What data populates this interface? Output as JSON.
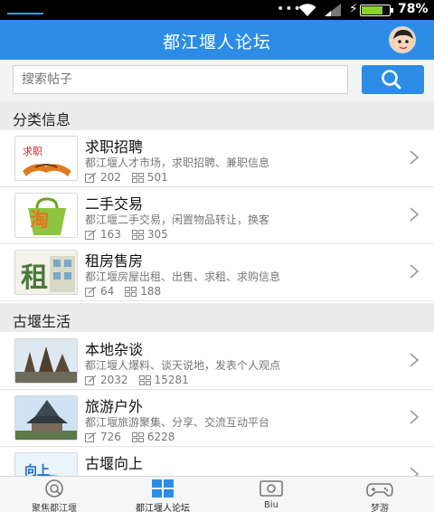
{
  "status_bar": {
    "battery_percent": "78%",
    "battery_level": 0.78
  },
  "header": {
    "title": "都江堰人论坛"
  },
  "search": {
    "placeholder": "搜索帖子"
  },
  "sections": [
    {
      "title": "分类信息",
      "items": [
        {
          "title": "求职招聘",
          "desc": "都江堰人才市场，求职招聘、兼职信息",
          "posts": "202",
          "views": "501",
          "thumb_text": "求职"
        },
        {
          "title": "二手交易",
          "desc": "都江堰二手交易，闲置物品转让，换客",
          "posts": "163",
          "views": "305",
          "thumb_text": "淘"
        },
        {
          "title": "租房售房",
          "desc": "都江堰房屋出租、出售、求租、求购信息",
          "posts": "64",
          "views": "188",
          "thumb_text": "租"
        }
      ]
    },
    {
      "title": "古堰生活",
      "items": [
        {
          "title": "本地杂谈",
          "desc": "都江堰人爆料、谈天说地，发表个人观点",
          "posts": "2032",
          "views": "15281"
        },
        {
          "title": "旅游户外",
          "desc": "都江堰旅游聚集、分享、交流互动平台",
          "posts": "726",
          "views": "6228"
        },
        {
          "title": "古堰向上",
          "desc": "",
          "posts": "",
          "views": "",
          "thumb_text": "向上"
        }
      ]
    }
  ],
  "tabs": [
    {
      "label": "聚焦都江堰",
      "icon": "focus-icon"
    },
    {
      "label": "都江堰人论坛",
      "icon": "forum-grid-icon",
      "active": true
    },
    {
      "label": "Biu",
      "icon": "biu-icon"
    },
    {
      "label": "梦游",
      "icon": "gamepad-icon"
    }
  ],
  "colors": {
    "brand": "#2c8ce6",
    "section_bg": "#ececec",
    "text_secondary": "#777777"
  }
}
